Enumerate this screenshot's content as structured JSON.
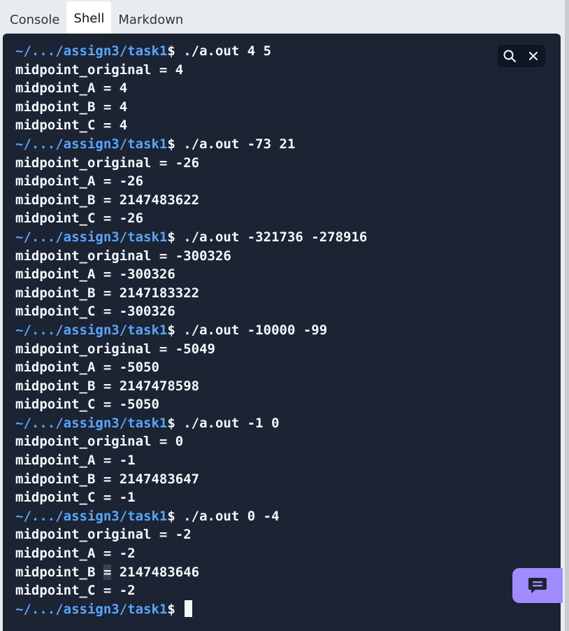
{
  "tabs": [
    {
      "label": "Console",
      "active": false
    },
    {
      "label": "Shell",
      "active": true
    },
    {
      "label": "Markdown",
      "active": false
    }
  ],
  "terminal": {
    "icons": {
      "search": "search-icon",
      "close": "close-icon",
      "chat": "chat-icon"
    },
    "colors": {
      "background": "#1c2333",
      "prompt_path": "#58a6ff",
      "text": "#f5f9fc",
      "chat_button": "#a08cff"
    },
    "lines": [
      {
        "type": "prompt",
        "path": "~/.../assign3/task1",
        "dollar": "$",
        "command": " ./a.out 4 5"
      },
      {
        "type": "output",
        "text": "midpoint_original = 4"
      },
      {
        "type": "output",
        "text": "midpoint_A = 4"
      },
      {
        "type": "output",
        "text": "midpoint_B = 4"
      },
      {
        "type": "output",
        "text": "midpoint_C = 4"
      },
      {
        "type": "prompt",
        "path": "~/.../assign3/task1",
        "dollar": "$",
        "command": " ./a.out -73 21"
      },
      {
        "type": "output",
        "text": "midpoint_original = -26"
      },
      {
        "type": "output",
        "text": "midpoint_A = -26"
      },
      {
        "type": "output",
        "text": "midpoint_B = 2147483622"
      },
      {
        "type": "output",
        "text": "midpoint_C = -26"
      },
      {
        "type": "prompt",
        "path": "~/.../assign3/task1",
        "dollar": "$",
        "command": " ./a.out -321736 -278916"
      },
      {
        "type": "output",
        "text": "midpoint_original = -300326"
      },
      {
        "type": "output",
        "text": "midpoint_A = -300326"
      },
      {
        "type": "output",
        "text": "midpoint_B = 2147183322"
      },
      {
        "type": "output",
        "text": "midpoint_C = -300326"
      },
      {
        "type": "prompt",
        "path": "~/.../assign3/task1",
        "dollar": "$",
        "command": " ./a.out -10000 -99"
      },
      {
        "type": "output",
        "text": "midpoint_original = -5049"
      },
      {
        "type": "output",
        "text": "midpoint_A = -5050"
      },
      {
        "type": "output",
        "text": "midpoint_B = 2147478598"
      },
      {
        "type": "output",
        "text": "midpoint_C = -5050"
      },
      {
        "type": "prompt",
        "path": "~/.../assign3/task1",
        "dollar": "$",
        "command": " ./a.out -1 0"
      },
      {
        "type": "output",
        "text": "midpoint_original = 0"
      },
      {
        "type": "output",
        "text": "midpoint_A = -1"
      },
      {
        "type": "output",
        "text": "midpoint_B = 2147483647"
      },
      {
        "type": "output",
        "text": "midpoint_C = -1"
      },
      {
        "type": "prompt",
        "path": "~/.../assign3/task1",
        "dollar": "$",
        "command": " ./a.out 0 -4"
      },
      {
        "type": "output",
        "text": "midpoint_original = -2"
      },
      {
        "type": "output",
        "text": "midpoint_A = -2"
      },
      {
        "type": "output_selected",
        "before": "midpoint_B ",
        "selected": "=",
        "after": " 2147483646"
      },
      {
        "type": "output",
        "text": "midpoint_C = -2"
      },
      {
        "type": "prompt_active",
        "path": "~/.../assign3/task1",
        "dollar": "$",
        "command": " "
      }
    ]
  }
}
